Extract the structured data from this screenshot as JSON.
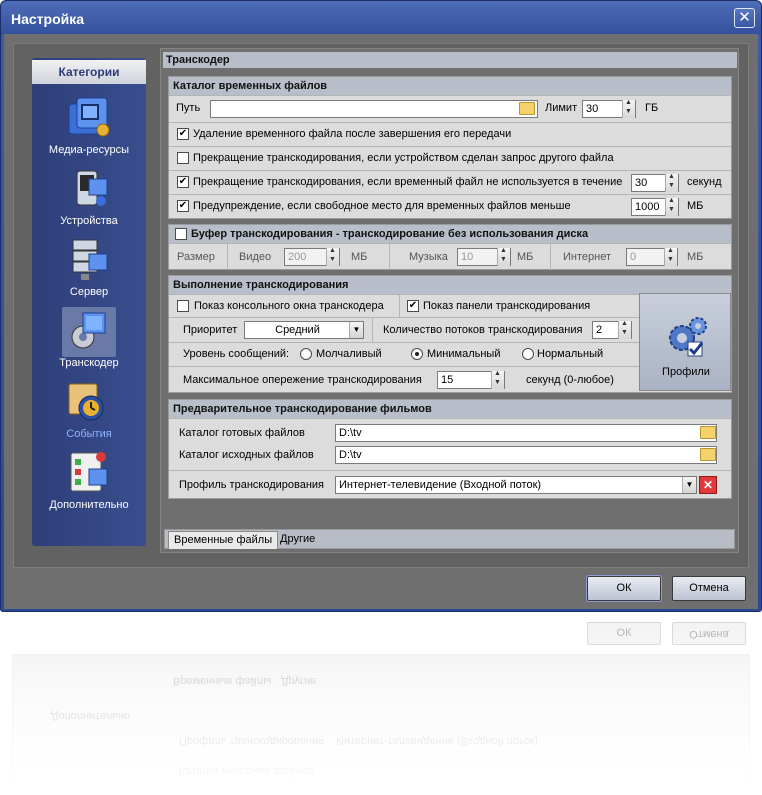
{
  "window": {
    "title": "Настройка",
    "close_icon": "close-icon"
  },
  "sidebar": {
    "header": "Категории",
    "items": [
      {
        "label": "Медиа-ресурсы",
        "icon": "media-resources-icon"
      },
      {
        "label": "Устройства",
        "icon": "devices-icon"
      },
      {
        "label": "Сервер",
        "icon": "server-icon"
      },
      {
        "label": "Транскодер",
        "icon": "transcoder-icon",
        "selected": true
      },
      {
        "label": "События",
        "icon": "events-icon"
      },
      {
        "label": "Дополнительно",
        "icon": "additional-icon"
      }
    ]
  },
  "main": {
    "title": "Транскодер",
    "temp_catalog": {
      "title": "Каталог временных файлов",
      "path_label": "Путь",
      "path_value": "",
      "limit_label": "Лимит",
      "limit_value": "30",
      "limit_unit": "ГБ",
      "delete_after_label": "Удаление временного файла после завершения его передачи",
      "delete_after_checked": true,
      "stop_on_other_request_label": "Прекращение транскодирования, если устройством сделан запрос другого файла",
      "stop_on_other_request_checked": false,
      "stop_unused_label": "Прекращение транскодирования, если временный файл не используется в течение",
      "stop_unused_checked": true,
      "stop_unused_value": "30",
      "stop_unused_unit": "секунд",
      "warn_space_label": "Предупреждение, если свободное место для временных файлов меньше",
      "warn_space_checked": true,
      "warn_space_value": "1000",
      "warn_space_unit": "МБ"
    },
    "buffer": {
      "title": "Буфер транскодирования - транскодирование без использования диска",
      "checked": false,
      "size_label": "Размер",
      "video_label": "Видео",
      "video_value": "200",
      "video_unit": "МБ",
      "music_label": "Музыка",
      "music_value": "10",
      "music_unit": "МБ",
      "internet_label": "Интернет",
      "internet_value": "0",
      "internet_unit": "МБ"
    },
    "execution": {
      "title": "Выполнение транскодирования",
      "show_console_label": "Показ консольного окна транскодера",
      "show_console_checked": false,
      "show_panel_label": "Показ панели транскодирования",
      "show_panel_checked": true,
      "priority_label": "Приоритет",
      "priority_value": "Средний",
      "threads_label": "Количество потоков транскодирования",
      "threads_value": "2",
      "message_level_label": "Уровень сообщений:",
      "level_options": [
        "Молчаливый",
        "Минимальный",
        "Нормальный"
      ],
      "level_selected": "Минимальный",
      "max_ahead_label": "Максимальное опережение транскодирования",
      "max_ahead_value": "15",
      "max_ahead_unit": "секунд (0-любое)",
      "profiles_button": "Профили"
    },
    "pre_transcode": {
      "title": "Предварительное транскодирование фильмов",
      "ready_catalog_label": "Каталог готовых файлов",
      "ready_catalog_value": "D:\\tv",
      "source_catalog_label": "Каталог исходных файлов",
      "source_catalog_value": "D:\\tv",
      "profile_label": "Профиль транскодирования",
      "profile_value": "Интернет-телевидение (Входной поток)"
    },
    "tabs": [
      "Временные файлы",
      "Другие"
    ]
  },
  "buttons": {
    "ok": "ОК",
    "cancel": "Отмена"
  },
  "colors": {
    "title_bar": "#3f5ba6",
    "sidebar": "#2d3e79",
    "group_header": "#b9bfca",
    "events_label": "#8fb4ff"
  }
}
